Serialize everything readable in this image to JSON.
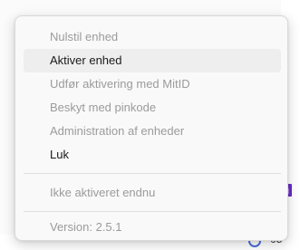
{
  "menu": {
    "items": [
      {
        "label": "Nulstil enhed",
        "enabled": false
      },
      {
        "label": "Aktiver enhed",
        "enabled": true
      },
      {
        "label": "Udfør aktivering med MitID",
        "enabled": false
      },
      {
        "label": "Beskyt med pinkode",
        "enabled": false
      },
      {
        "label": "Administration af enheder",
        "enabled": false
      },
      {
        "label": "Luk",
        "enabled": true
      }
    ],
    "status": "Ikke aktiveret endnu",
    "version": "Version: 2.5.1"
  },
  "taskbar": {
    "partial_text": "ˢ05'"
  }
}
